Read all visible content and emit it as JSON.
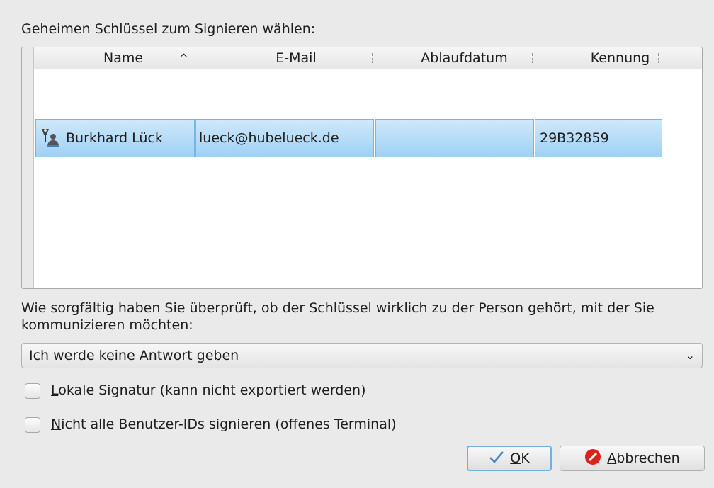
{
  "dialog": {
    "prompt": "Geheimen Schlüssel zum Signieren wählen:",
    "table": {
      "columns": [
        "Name",
        "E-Mail",
        "Ablaufdatum",
        "Kennung"
      ],
      "rows": [
        {
          "name": "Burkhard Lück",
          "email": "lueck@hubelueck.de",
          "expiry": "",
          "id": "29B32859",
          "icon": "secret-key-icon"
        }
      ]
    },
    "question": "Wie sorgfältig haben Sie überprüft, ob der Schlüssel wirklich zu der Person gehört, mit der Sie kommunizieren möchten:",
    "trust_select": {
      "value": "Ich werde keine Antwort geben"
    },
    "checkboxes": [
      {
        "mnemonic": "L",
        "rest": "okale Signatur (kann nicht exportiert werden)",
        "checked": false
      },
      {
        "mnemonic": "N",
        "rest": "icht alle Benutzer-IDs signieren (offenes Terminal)",
        "checked": false
      }
    ],
    "buttons": {
      "ok": {
        "mnemonic": "O",
        "rest": "K",
        "icon": "checkmark-icon"
      },
      "cancel": {
        "mnemonic": "A",
        "rest": "bbrechen",
        "icon": "cancel-icon"
      }
    }
  }
}
